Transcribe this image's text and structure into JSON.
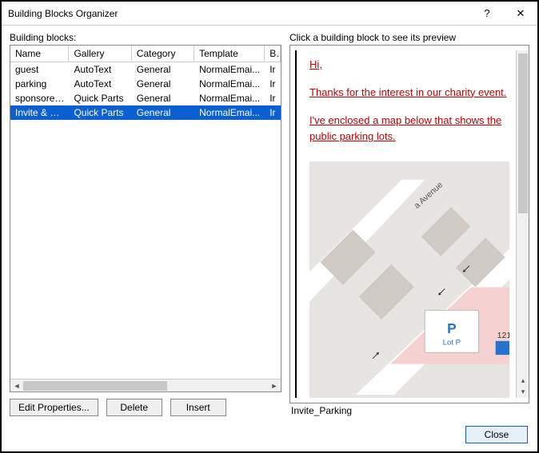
{
  "window": {
    "title": "Building Blocks Organizer",
    "help": "?",
    "close": "✕"
  },
  "left": {
    "label": "Building blocks:",
    "columns": {
      "name": "Name",
      "gallery": "Gallery",
      "category": "Category",
      "template": "Template",
      "b": "B"
    },
    "rows": [
      {
        "name": "guest",
        "gallery": "AutoText",
        "category": "General",
        "template": "NormalEmai...",
        "b": "Ir",
        "selected": false
      },
      {
        "name": "parking",
        "gallery": "AutoText",
        "category": "General",
        "template": "NormalEmai...",
        "b": "Ir",
        "selected": false
      },
      {
        "name": "sponsored ...",
        "gallery": "Quick Parts",
        "category": "General",
        "template": "NormalEmai...",
        "b": "Ir",
        "selected": false
      },
      {
        "name": "Invite & Par...",
        "gallery": "Quick Parts",
        "category": "General",
        "template": "NormalEmai...",
        "b": "Ir",
        "selected": true
      }
    ],
    "buttons": {
      "edit": "Edit Properties...",
      "delete": "Delete",
      "insert": "Insert"
    }
  },
  "right": {
    "label": "Click a building block to see its preview",
    "preview_paragraphs": [
      "Hi,",
      "Thanks for the interest in our charity event.",
      "I've enclosed a map below that shows the public parking lots."
    ],
    "map": {
      "avenue": "a Avenue",
      "p_symbol": "P",
      "p_label": "Lot P",
      "num": "121"
    },
    "block_name": "Invite_Parking"
  },
  "footer": {
    "close": "Close"
  }
}
